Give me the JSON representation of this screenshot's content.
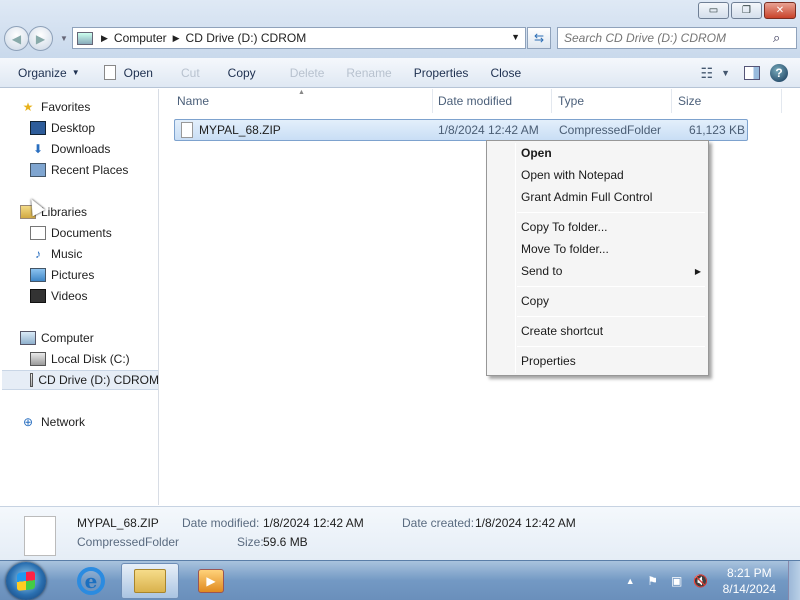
{
  "window": {
    "controls": {
      "minimize": "▭",
      "maximize": "❐",
      "close": "✕"
    }
  },
  "address": {
    "crumbs": [
      "Computer",
      "CD Drive (D:) CDROM"
    ],
    "search_placeholder": "Search CD Drive (D:) CDROM"
  },
  "toolbar": {
    "organize": "Organize",
    "open": "Open",
    "cut": "Cut",
    "copy": "Copy",
    "delete": "Delete",
    "rename": "Rename",
    "properties": "Properties",
    "close": "Close"
  },
  "nav": {
    "favorites": "Favorites",
    "desktop": "Desktop",
    "downloads": "Downloads",
    "recent_places": "Recent Places",
    "libraries": "Libraries",
    "documents": "Documents",
    "music": "Music",
    "pictures": "Pictures",
    "videos": "Videos",
    "computer": "Computer",
    "local_disk": "Local Disk (C:)",
    "cd_drive": "CD Drive (D:) CDROM",
    "network": "Network"
  },
  "columns": {
    "name": "Name",
    "date_modified": "Date modified",
    "type": "Type",
    "size": "Size"
  },
  "file": {
    "name": "MYPAL_68.ZIP",
    "date_modified": "1/8/2024 12:42 AM",
    "type": "CompressedFolder",
    "size": "61,123 KB"
  },
  "context_menu": {
    "open": "Open",
    "open_with_notepad": "Open with Notepad",
    "grant_admin": "Grant Admin Full Control",
    "copy_to_folder": "Copy To folder...",
    "move_to_folder": "Move To folder...",
    "send_to": "Send to",
    "copy": "Copy",
    "create_shortcut": "Create shortcut",
    "properties": "Properties"
  },
  "details": {
    "name": "MYPAL_68.ZIP",
    "type": "CompressedFolder",
    "date_modified_label": "Date modified:",
    "date_modified": "1/8/2024 12:42 AM",
    "size_label": "Size:",
    "size": "59.6 MB",
    "date_created_label": "Date created:",
    "date_created": "1/8/2024 12:42 AM"
  },
  "taskbar": {
    "time": "8:21 PM",
    "date": "8/14/2024"
  }
}
